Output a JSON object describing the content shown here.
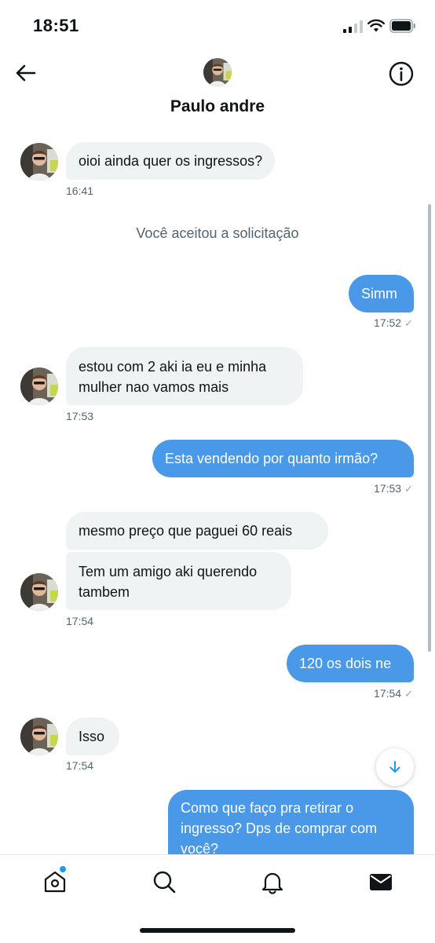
{
  "status_bar": {
    "time": "18:51"
  },
  "header": {
    "name": "Paulo andre"
  },
  "system_message": "Você aceitou a solicitação",
  "messages": [
    {
      "text": "oioi ainda quer os ingressos?",
      "time": "16:41"
    },
    {
      "text": "Simm",
      "time": "17:52",
      "check": "✓"
    },
    {
      "text": "estou com 2 aki ia eu e minha mulher nao vamos mais",
      "time": "17:53"
    },
    {
      "text": "Esta vendendo por quanto irmão?",
      "time": "17:53",
      "check": "✓"
    },
    {
      "text": "mesmo preço que paguei 60 reais"
    },
    {
      "text": "Tem um amigo aki querendo tambem",
      "time": "17:54"
    },
    {
      "text": "120 os dois ne",
      "time": "17:54",
      "check": "✓"
    },
    {
      "text": "Isso",
      "time": "17:54"
    },
    {
      "text": "Como que faço pra retirar o ingresso? Dps de comprar com você?"
    }
  ],
  "nav": {
    "items": [
      "home-icon",
      "search-icon",
      "bell-icon",
      "mail-icon"
    ],
    "notification_dot": true
  },
  "colors": {
    "sent_bubble": "#4a99e9",
    "received_bubble": "#eff3f4",
    "accent": "#1d9bf0"
  }
}
